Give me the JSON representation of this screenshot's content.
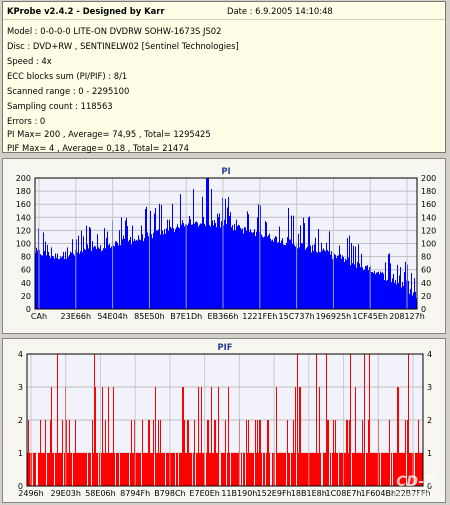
{
  "app": {
    "title": "KProbe v2.4.2 - Designed by Karr",
    "date": "Date : 6.9.2005 14:10:48"
  },
  "info": [
    "Model : 0-0-0-0 LITE-ON DVDRW SOHW-1673S JS02",
    "Disc : DVD+RW , SENTINELW02 [Sentinel Technologies]",
    "Speed : 4x",
    "ECC blocks sum (PI/PIF) : 8/1",
    "Scanned range : 0 - 2295100",
    "Sampling count : 118563",
    "Errors : 0",
    "PI Max= 200 , Average= 74,95 , Total= 1295425",
    "PIF Max= 4 , Average= 0,18 , Total= 21474"
  ],
  "watermark": {
    "logo": "CD-R",
    "site": "www.cdr.cz"
  },
  "colors": {
    "pi_fill": "#0000ff",
    "pif_fill": "#ff0000",
    "grid": "#c0c0c0",
    "title": "#2b3c9a",
    "header_bg": "#ffffe8"
  },
  "chart_data": [
    {
      "type": "area",
      "title": "PI",
      "x_tick_labels": [
        "CAh",
        "23E66h",
        "54E04h",
        "85E50h",
        "B7E1Dh",
        "EB366h",
        "1221FEh",
        "15C737h",
        "196925h",
        "1CF45Eh",
        "208127h"
      ],
      "y_ticks": [
        0,
        20,
        40,
        60,
        80,
        100,
        120,
        140,
        160,
        180,
        200
      ],
      "ylim": [
        0,
        200
      ],
      "grid": true,
      "envelope_x": [
        0,
        0.05,
        0.1,
        0.2,
        0.3,
        0.4,
        0.45,
        0.5,
        0.6,
        0.7,
        0.8,
        0.85,
        0.9,
        0.95,
        1.0
      ],
      "envelope_baseline": [
        88,
        80,
        84,
        96,
        112,
        128,
        132,
        128,
        112,
        96,
        78,
        66,
        54,
        40,
        20
      ],
      "envelope_spikes": [
        130,
        120,
        125,
        140,
        160,
        180,
        195,
        185,
        165,
        150,
        130,
        115,
        100,
        85,
        60
      ],
      "max": 200,
      "average": 74.95
    },
    {
      "type": "area",
      "title": "PIF",
      "x_tick_labels": [
        "2496h",
        "29E03h",
        "58E06h",
        "8794Fh",
        "B798Ch",
        "E7E0Eh",
        "11B190h",
        "152E9Fh",
        "18B1E8h",
        "1C08E7h",
        "1F604Bh",
        "22B7FFh"
      ],
      "y_ticks": [
        0,
        1,
        2,
        3,
        4
      ],
      "ylim": [
        0,
        4
      ],
      "grid": true,
      "value_levels": [
        0,
        1,
        2,
        3,
        4
      ],
      "max": 4,
      "average": 0.18
    }
  ]
}
